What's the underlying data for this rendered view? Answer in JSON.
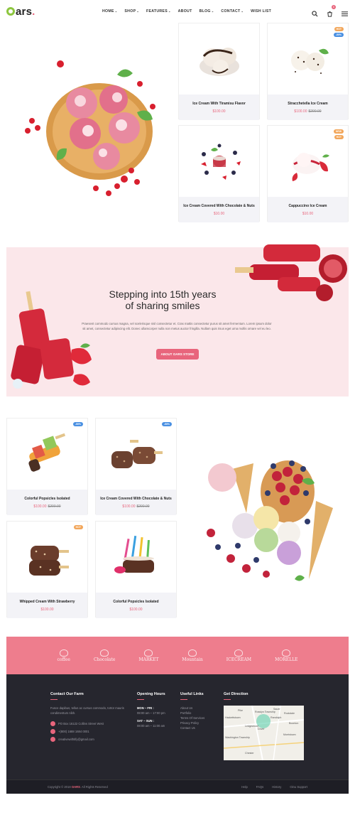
{
  "brand": {
    "name": "ars",
    "first_letter": "O"
  },
  "nav": {
    "items": [
      {
        "label": "HOME",
        "caret": "⌄",
        "active": true
      },
      {
        "label": "SHOP",
        "caret": "⌄"
      },
      {
        "label": "FEATURES",
        "caret": "⌄"
      },
      {
        "label": "ABOUT",
        "caret": ""
      },
      {
        "label": "BLOG",
        "caret": "⌄"
      },
      {
        "label": "CONTACT",
        "caret": "⌄"
      },
      {
        "label": "WISH LIST",
        "caret": ""
      }
    ]
  },
  "header": {
    "cart_count": "0"
  },
  "products_top": [
    {
      "name": "Ice Cream With Tiramisu Flavor",
      "price": "$100.00",
      "old_price": "",
      "badges": []
    },
    {
      "name": "Stracchetella Ice Cream",
      "price": "$100.00",
      "old_price": "$200.00",
      "badges": [
        "HOT",
        "-50%"
      ]
    },
    {
      "name": "Ice Cream Covered With Chocolate & Nuts",
      "price": "$10.00",
      "old_price": "",
      "badges": []
    },
    {
      "name": "Cappuccino Ice Cream",
      "price": "$10.00",
      "old_price": "",
      "badges": [
        "NEW",
        "HOT"
      ]
    }
  ],
  "story": {
    "title_line1": "Stepping into 15th years",
    "title_line2": "of sharing smiles",
    "body": "Praesent commodo cursus magna, vel scelerisque nisl consectetur et. Cras mattis consectetur purus sit amet fermentum. Lorem ipsum dolor sit amet, consectetur adipiscing elit. Donec ullamcorper nulla non metus auctor fringilla. Nullam quis risus eget urna mollis ornare vel eu leo.",
    "button": "ABOUT OARS STORE"
  },
  "products_bottom": [
    {
      "name": "Colorful Popsicles Isolated",
      "price": "$100.00",
      "old_price": "$200.00",
      "badges": [
        "-50%"
      ]
    },
    {
      "name": "Ice Cream Covered With Chocolate & Nuts",
      "price": "$100.00",
      "old_price": "$200.00",
      "badges": [
        "-50%"
      ]
    },
    {
      "name": "Whipped Cream With Strawberry",
      "price": "$100.00",
      "old_price": "",
      "badges": [
        "HOT"
      ]
    },
    {
      "name": "Colorful Popsicles Isolated",
      "price": "$100.00",
      "old_price": "",
      "badges": []
    }
  ],
  "brands": [
    "coffee",
    "Chocolate",
    "MARKET",
    "Mountain",
    "ICECREAM",
    "MORELLE"
  ],
  "footer": {
    "contact": {
      "heading": "Contact Our Farm",
      "text": "Fusce dapibus, tellus ac cursus commodo, tortor mauris condimentum nibh.",
      "address": "PO Box 16122 Collins Street West",
      "phone": "+(800) 1688 1684 0001",
      "email": "creativewithtify@gmail.com"
    },
    "hours": {
      "heading": "Opening Hours",
      "row1_days": "MON – FRI :",
      "row1_time": "08:00 am – 17:00 pm",
      "row2_days": "SAT – SUN :",
      "row2_time": "08:00 am – 11:00 am"
    },
    "links": {
      "heading": "Useful Links",
      "items": [
        "About Us",
        "Portfolio",
        "Terms Of Services",
        "Privacy Policy",
        "Contact Us"
      ]
    },
    "direction": {
      "heading": "Get Direction",
      "map_labels": [
        "Rosslyn Township",
        "Pike",
        "Sauer",
        "Rockdale",
        "Hackettstown",
        "Randolph",
        "Dover",
        "Ledgewood",
        "Boonton",
        "Morristown",
        "Washington Township",
        "Chester"
      ]
    }
  },
  "copyright": {
    "prefix": "Copyright © 2018",
    "brand": "OARS",
    "suffix": ". All Rights Reserved",
    "links": [
      "Help",
      "FAQs",
      "History",
      "Oinu Support"
    ]
  },
  "colors": {
    "accent": "#e8657c",
    "brand_green": "#8dc63f",
    "band_pink": "#fbe7ea",
    "footer_bg": "#26262e"
  }
}
